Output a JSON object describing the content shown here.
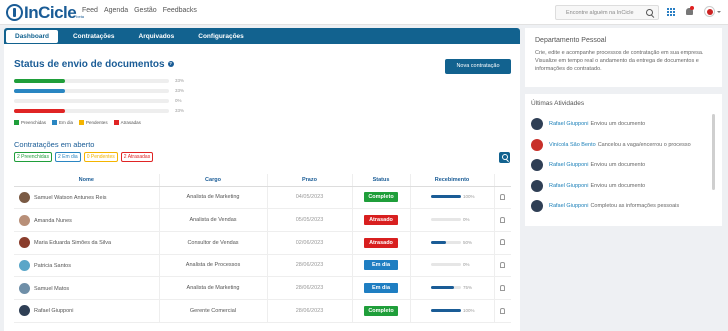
{
  "topbar": {
    "logo_text": "InCicle",
    "logo_sup": "beta",
    "nav": [
      "Feed",
      "Agenda",
      "Gestão",
      "Feedbacks"
    ],
    "search_placeholder": "Encontre alguém na InCicle"
  },
  "tabs": [
    {
      "label": "Dashboard",
      "active": true
    },
    {
      "label": "Contratações",
      "active": false
    },
    {
      "label": "Arquivados",
      "active": false
    },
    {
      "label": "Configurações",
      "active": false
    }
  ],
  "status": {
    "title": "Status de envio de documentos",
    "new_button": "Nova contratação",
    "bars": [
      {
        "color": "#1f9e3a",
        "fill": 0.33,
        "pct": "33%"
      },
      {
        "color": "#2a86c2",
        "fill": 0.33,
        "pct": "33%"
      },
      {
        "color": "#f4b400",
        "fill": 0.0,
        "pct": "0%"
      },
      {
        "color": "#e02424",
        "fill": 0.33,
        "pct": "33%"
      }
    ],
    "legend": [
      {
        "label": "Preenchidas",
        "color": "#1f9e3a"
      },
      {
        "label": "Em dia",
        "color": "#2a86c2"
      },
      {
        "label": "Pendentes",
        "color": "#f4b400"
      },
      {
        "label": "Atrasadas",
        "color": "#e02424"
      }
    ]
  },
  "open": {
    "title": "Contratações em aberto",
    "chips": [
      {
        "label": "2 Preenchidas",
        "color": "#1f9e3a"
      },
      {
        "label": "2 Em dia",
        "color": "#2a86c2"
      },
      {
        "label": "0 Pendentes",
        "color": "#f4b400"
      },
      {
        "label": "2 Atrasadas",
        "color": "#e02424"
      }
    ],
    "columns": [
      "Nome",
      "Cargo",
      "Prazo",
      "Status",
      "Recebimento"
    ],
    "rows": [
      {
        "name": "Samuel Watson Antunes Reis",
        "role": "Analista de Marketing",
        "due": "04/05/2023",
        "status": "Completo",
        "status_color": "#1f9e3a",
        "progress": 1.0,
        "pct": "100%",
        "avatar": "#7a5a44"
      },
      {
        "name": "Amanda Nunes",
        "role": "Analista de Vendas",
        "due": "05/05/2023",
        "status": "Atrasado",
        "status_color": "#d81f1f",
        "progress": 0.0,
        "pct": "0%",
        "avatar": "#b88f78"
      },
      {
        "name": "Maria Eduarda Simões da Silva",
        "role": "Consultor de Vendas",
        "due": "02/06/2023",
        "status": "Atrasado",
        "status_color": "#d81f1f",
        "progress": 0.5,
        "pct": "50%",
        "avatar": "#8a3d2c"
      },
      {
        "name": "Patricia Santos",
        "role": "Analista de Processos",
        "due": "28/06/2023",
        "status": "Em dia",
        "status_color": "#1f7ec2",
        "progress": 0.0,
        "pct": "0%",
        "avatar": "#5aa6c8"
      },
      {
        "name": "Samuel Matos",
        "role": "Analista de Marketing",
        "due": "28/06/2023",
        "status": "Em dia",
        "status_color": "#1f7ec2",
        "progress": 0.75,
        "pct": "75%",
        "avatar": "#6f8fa8"
      },
      {
        "name": "Rafael Giupponi",
        "role": "Gerente Comercial",
        "due": "28/06/2023",
        "status": "Completo",
        "status_color": "#1f9e3a",
        "progress": 1.0,
        "pct": "100%",
        "avatar": "#2f3f55"
      }
    ]
  },
  "dept": {
    "title": "Departamento Pessoal",
    "description": "Crie, edite e acompanhe processos de contratação em sua empresa. Visualize em tempo real o andamento da entrega de documentos e informações do contratado."
  },
  "activities": {
    "title": "Últimas Atividades",
    "items": [
      {
        "who": "Rafael Giupponi",
        "what": "Enviou um documento",
        "avatar": "#2f3f55"
      },
      {
        "who": "Vinícola São Bento",
        "what": "Cancelou a vaga/encerrou o processo",
        "avatar": "#c8302a"
      },
      {
        "who": "Rafael Giupponi",
        "what": "Enviou um documento",
        "avatar": "#2f3f55"
      },
      {
        "who": "Rafael Giupponi",
        "what": "Enviou um documento",
        "avatar": "#2f3f55"
      },
      {
        "who": "Rafael Giupponi",
        "what": "Completou as informações pessoais",
        "avatar": "#2f3f55"
      }
    ]
  }
}
